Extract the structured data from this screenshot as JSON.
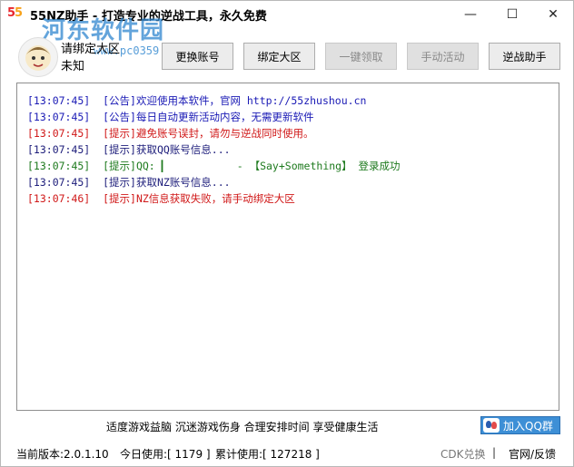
{
  "window": {
    "logo": {
      "part1": "5",
      "part2": "5"
    },
    "title": "55NZ助手 - 打造专业的逆战工具，永久免费",
    "watermark": "河东软件园",
    "watermark_url": "www.pc0359.cn",
    "controls": {
      "minimize": "—",
      "maximize": "☐",
      "close": "✕"
    }
  },
  "user": {
    "line1": "请绑定大区",
    "line2": "未知"
  },
  "toolbar": {
    "change_account": "更换账号",
    "bind_region": "绑定大区",
    "one_click_claim": "一键领取",
    "manual_activity": "手动活动",
    "nz_helper": "逆战助手"
  },
  "log": [
    {
      "time": "[13:07:45]",
      "text": "[公告]欢迎使用本软件，官网 http://55zhushou.cn",
      "color": "blue"
    },
    {
      "time": "[13:07:45]",
      "text": "[公告]每日自动更新活动内容，无需更新软件",
      "color": "blue"
    },
    {
      "time": "[13:07:45]",
      "text": "[提示]避免账号误封，请勿与逆战同时使用。",
      "color": "red"
    },
    {
      "time": "[13:07:45]",
      "text": "[提示]获取QQ账号信息...",
      "color": "navy"
    },
    {
      "time": "[13:07:45]",
      "text": "[提示]QQ: ▎           - 【Say+Something】 登录成功",
      "color": "green"
    },
    {
      "time": "[13:07:45]",
      "text": "[提示]获取NZ账号信息...",
      "color": "navy"
    },
    {
      "time": "[13:07:46]",
      "text": "[提示]NZ信息获取失败，请手动绑定大区",
      "color": "red"
    }
  ],
  "slogan": "适度游戏益脑 沉迷游戏伤身 合理安排时间 享受健康生活",
  "qq_button": "加入QQ群",
  "status": {
    "version": "当前版本:2.0.1.10",
    "today": "今日使用:[ 1179 ]",
    "total": "累计使用:[ 127218 ]",
    "cdk": "CDK兑换",
    "separator": "|",
    "feedback": "官网/反馈"
  }
}
